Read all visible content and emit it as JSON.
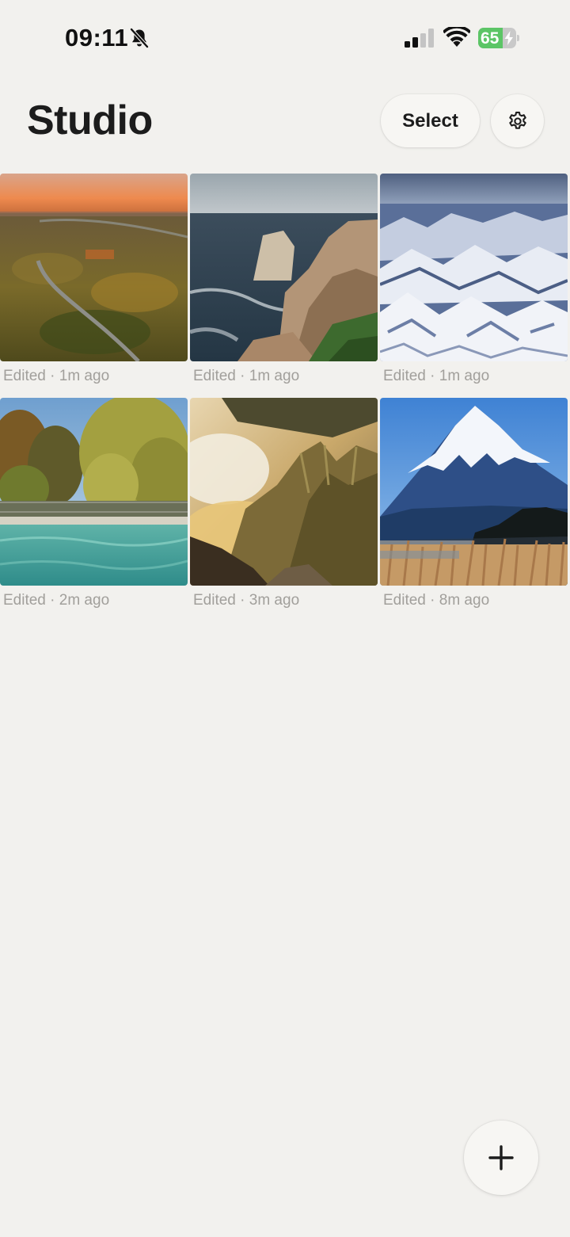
{
  "status_bar": {
    "time": "09:11",
    "battery_percent": "65",
    "battery_level": 0.65,
    "battery_color": "#5cc566",
    "icons": [
      "bell-slash-icon",
      "cellular-signal-icon",
      "wifi-icon",
      "battery-charging-icon"
    ]
  },
  "header": {
    "title": "Studio",
    "select_label": "Select",
    "settings_icon": "gear-icon"
  },
  "photos": [
    {
      "caption": "Edited · 1m ago",
      "scene": "aerial countryside road at sunset"
    },
    {
      "caption": "Edited · 1m ago",
      "scene": "coastal cliffs and sea"
    },
    {
      "caption": "Edited · 1m ago",
      "scene": "snowy mountain range from above"
    },
    {
      "caption": "Edited · 2m ago",
      "scene": "swimming pool with autumn trees"
    },
    {
      "caption": "Edited · 3m ago",
      "scene": "mountain peaks above golden clouds"
    },
    {
      "caption": "Edited · 8m ago",
      "scene": "snow-capped volcano over lake"
    }
  ],
  "fab": {
    "icon": "plus-icon"
  },
  "colors": {
    "background": "#f2f1ee",
    "text": "#1c1c1c",
    "caption": "#a19f9b",
    "button_bg": "#f7f6f3"
  }
}
